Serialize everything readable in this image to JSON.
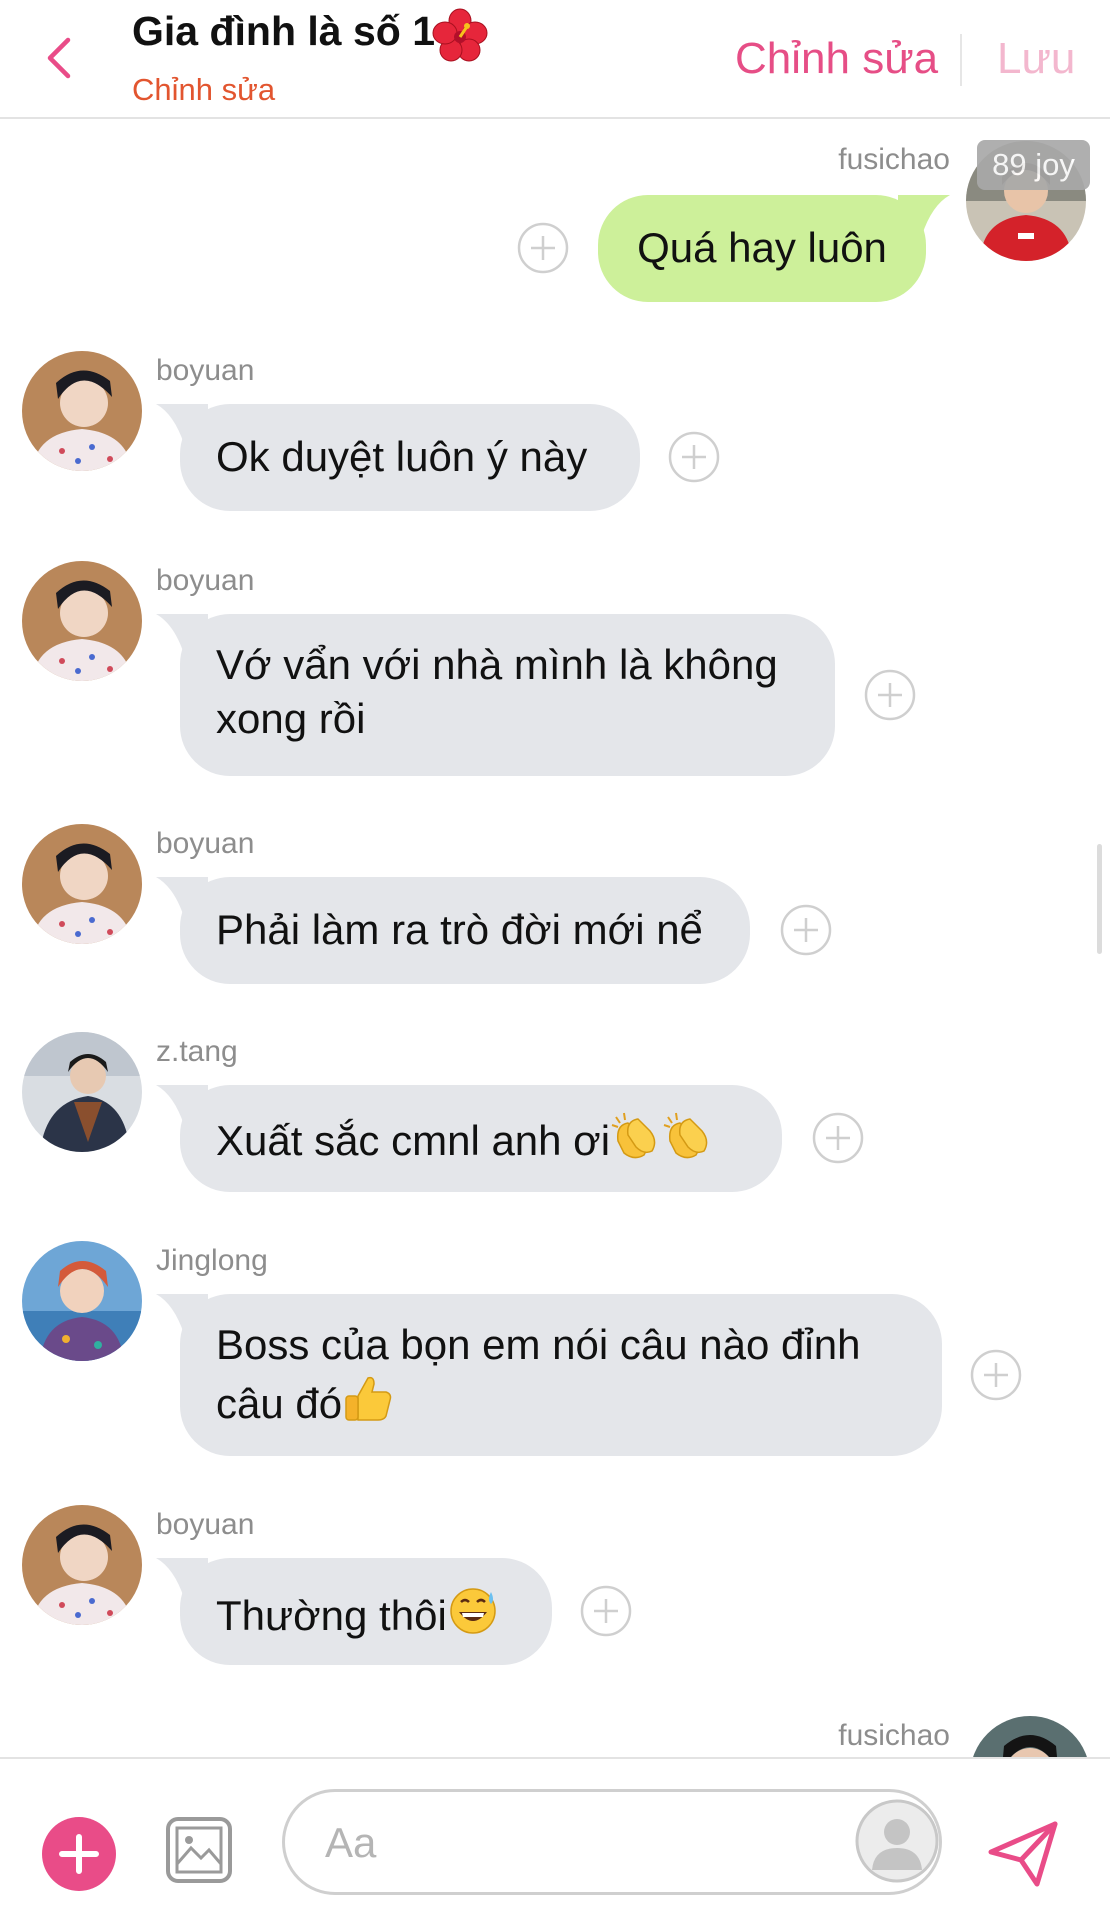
{
  "header": {
    "title": "Gia đình là số 1",
    "title_emoji": "hibiscus",
    "subtitle": "Chỉnh sửa",
    "edit_label": "Chỉnh sửa",
    "save_label": "Lưu"
  },
  "messages": [
    {
      "side": "out",
      "sender": "fusichao",
      "text": "Quá hay luôn",
      "badge": "89 joy"
    },
    {
      "side": "in",
      "sender": "boyuan",
      "text": "Ok duyệt luôn ý này"
    },
    {
      "side": "in",
      "sender": "boyuan",
      "text_line1": "Vớ vẩn với nhà mình là không",
      "text_line2": "xong rồi"
    },
    {
      "side": "in",
      "sender": "boyuan",
      "text": "Phải làm ra trò đời mới nể"
    },
    {
      "side": "in",
      "sender": "z.tang",
      "text": "Xuất sắc cmnl anh ơi",
      "emojis": [
        "clapping-hands",
        "clapping-hands"
      ]
    },
    {
      "side": "in",
      "sender": "Jinglong",
      "text_line1": "Boss của bọn em nói câu nào đỉnh",
      "text_line2": "câu đó",
      "emojis": [
        "thumbs-up"
      ]
    },
    {
      "side": "in",
      "sender": "boyuan",
      "text": "Thường thôi",
      "emojis": [
        "grinning-sweat"
      ]
    },
    {
      "side": "out",
      "sender": "fusichao"
    }
  ],
  "composer": {
    "placeholder": "Aa"
  },
  "colors": {
    "accent_pink": "#e94c88",
    "save_disabled": "#f3b7ce",
    "subtitle_orange": "#e2552f",
    "outgoing_bubble": "#cdf09a",
    "incoming_bubble": "#e4e6ea"
  }
}
